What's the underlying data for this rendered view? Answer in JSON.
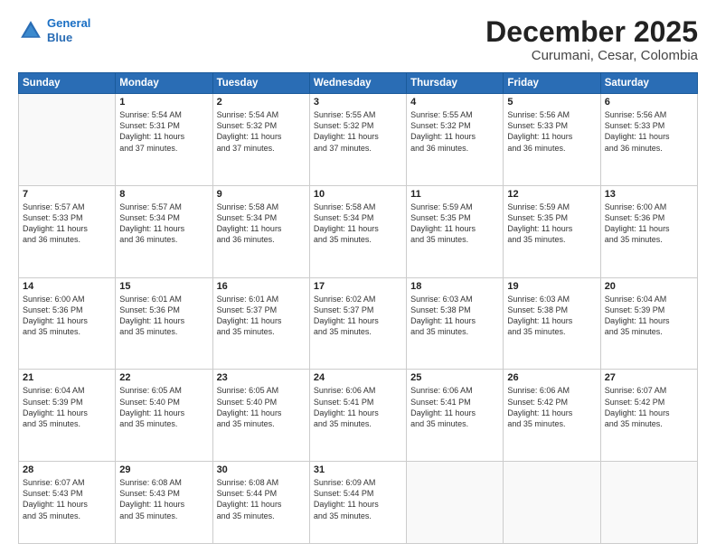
{
  "logo": {
    "line1": "General",
    "line2": "Blue"
  },
  "title": "December 2025",
  "subtitle": "Curumani, Cesar, Colombia",
  "header_days": [
    "Sunday",
    "Monday",
    "Tuesday",
    "Wednesday",
    "Thursday",
    "Friday",
    "Saturday"
  ],
  "weeks": [
    [
      {
        "day": "",
        "info": ""
      },
      {
        "day": "1",
        "info": "Sunrise: 5:54 AM\nSunset: 5:31 PM\nDaylight: 11 hours\nand 37 minutes."
      },
      {
        "day": "2",
        "info": "Sunrise: 5:54 AM\nSunset: 5:32 PM\nDaylight: 11 hours\nand 37 minutes."
      },
      {
        "day": "3",
        "info": "Sunrise: 5:55 AM\nSunset: 5:32 PM\nDaylight: 11 hours\nand 37 minutes."
      },
      {
        "day": "4",
        "info": "Sunrise: 5:55 AM\nSunset: 5:32 PM\nDaylight: 11 hours\nand 36 minutes."
      },
      {
        "day": "5",
        "info": "Sunrise: 5:56 AM\nSunset: 5:33 PM\nDaylight: 11 hours\nand 36 minutes."
      },
      {
        "day": "6",
        "info": "Sunrise: 5:56 AM\nSunset: 5:33 PM\nDaylight: 11 hours\nand 36 minutes."
      }
    ],
    [
      {
        "day": "7",
        "info": "Sunrise: 5:57 AM\nSunset: 5:33 PM\nDaylight: 11 hours\nand 36 minutes."
      },
      {
        "day": "8",
        "info": "Sunrise: 5:57 AM\nSunset: 5:34 PM\nDaylight: 11 hours\nand 36 minutes."
      },
      {
        "day": "9",
        "info": "Sunrise: 5:58 AM\nSunset: 5:34 PM\nDaylight: 11 hours\nand 36 minutes."
      },
      {
        "day": "10",
        "info": "Sunrise: 5:58 AM\nSunset: 5:34 PM\nDaylight: 11 hours\nand 35 minutes."
      },
      {
        "day": "11",
        "info": "Sunrise: 5:59 AM\nSunset: 5:35 PM\nDaylight: 11 hours\nand 35 minutes."
      },
      {
        "day": "12",
        "info": "Sunrise: 5:59 AM\nSunset: 5:35 PM\nDaylight: 11 hours\nand 35 minutes."
      },
      {
        "day": "13",
        "info": "Sunrise: 6:00 AM\nSunset: 5:36 PM\nDaylight: 11 hours\nand 35 minutes."
      }
    ],
    [
      {
        "day": "14",
        "info": "Sunrise: 6:00 AM\nSunset: 5:36 PM\nDaylight: 11 hours\nand 35 minutes."
      },
      {
        "day": "15",
        "info": "Sunrise: 6:01 AM\nSunset: 5:36 PM\nDaylight: 11 hours\nand 35 minutes."
      },
      {
        "day": "16",
        "info": "Sunrise: 6:01 AM\nSunset: 5:37 PM\nDaylight: 11 hours\nand 35 minutes."
      },
      {
        "day": "17",
        "info": "Sunrise: 6:02 AM\nSunset: 5:37 PM\nDaylight: 11 hours\nand 35 minutes."
      },
      {
        "day": "18",
        "info": "Sunrise: 6:03 AM\nSunset: 5:38 PM\nDaylight: 11 hours\nand 35 minutes."
      },
      {
        "day": "19",
        "info": "Sunrise: 6:03 AM\nSunset: 5:38 PM\nDaylight: 11 hours\nand 35 minutes."
      },
      {
        "day": "20",
        "info": "Sunrise: 6:04 AM\nSunset: 5:39 PM\nDaylight: 11 hours\nand 35 minutes."
      }
    ],
    [
      {
        "day": "21",
        "info": "Sunrise: 6:04 AM\nSunset: 5:39 PM\nDaylight: 11 hours\nand 35 minutes."
      },
      {
        "day": "22",
        "info": "Sunrise: 6:05 AM\nSunset: 5:40 PM\nDaylight: 11 hours\nand 35 minutes."
      },
      {
        "day": "23",
        "info": "Sunrise: 6:05 AM\nSunset: 5:40 PM\nDaylight: 11 hours\nand 35 minutes."
      },
      {
        "day": "24",
        "info": "Sunrise: 6:06 AM\nSunset: 5:41 PM\nDaylight: 11 hours\nand 35 minutes."
      },
      {
        "day": "25",
        "info": "Sunrise: 6:06 AM\nSunset: 5:41 PM\nDaylight: 11 hours\nand 35 minutes."
      },
      {
        "day": "26",
        "info": "Sunrise: 6:06 AM\nSunset: 5:42 PM\nDaylight: 11 hours\nand 35 minutes."
      },
      {
        "day": "27",
        "info": "Sunrise: 6:07 AM\nSunset: 5:42 PM\nDaylight: 11 hours\nand 35 minutes."
      }
    ],
    [
      {
        "day": "28",
        "info": "Sunrise: 6:07 AM\nSunset: 5:43 PM\nDaylight: 11 hours\nand 35 minutes."
      },
      {
        "day": "29",
        "info": "Sunrise: 6:08 AM\nSunset: 5:43 PM\nDaylight: 11 hours\nand 35 minutes."
      },
      {
        "day": "30",
        "info": "Sunrise: 6:08 AM\nSunset: 5:44 PM\nDaylight: 11 hours\nand 35 minutes."
      },
      {
        "day": "31",
        "info": "Sunrise: 6:09 AM\nSunset: 5:44 PM\nDaylight: 11 hours\nand 35 minutes."
      },
      {
        "day": "",
        "info": ""
      },
      {
        "day": "",
        "info": ""
      },
      {
        "day": "",
        "info": ""
      }
    ]
  ]
}
